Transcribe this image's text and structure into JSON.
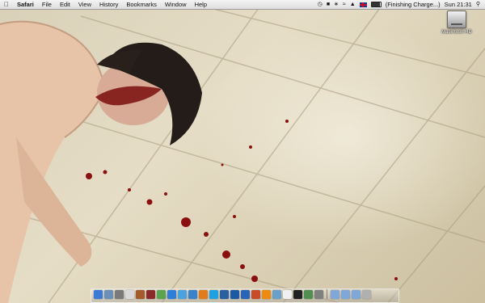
{
  "menubar": {
    "app_name": "Safari",
    "items": [
      "File",
      "Edit",
      "View",
      "History",
      "Bookmarks",
      "Window",
      "Help"
    ],
    "battery_status": "(Finishing Charge...)",
    "battery_level": 0.95,
    "clock": "Sun 21:31",
    "status_icons": [
      "time-machine-icon",
      "adium-icon",
      "bluetooth-icon",
      "wifi-icon",
      "volume-icon",
      "flag-uk-icon",
      "battery-icon",
      "spotlight-icon"
    ]
  },
  "desktop": {
    "hd_label": "Macintosh HD"
  },
  "dock": {
    "items": [
      {
        "name": "finder-icon",
        "color": "#3a7bd5"
      },
      {
        "name": "mail-icon",
        "color": "#6c8fb8"
      },
      {
        "name": "system-preferences-icon",
        "color": "#7a7a7a"
      },
      {
        "name": "ical-icon",
        "color": "#d9d9d9"
      },
      {
        "name": "address-book-icon",
        "color": "#a45a2a"
      },
      {
        "name": "dictionary-icon",
        "color": "#8a2a2a"
      },
      {
        "name": "iphoto-icon",
        "color": "#5ba34f"
      },
      {
        "name": "safari-icon",
        "color": "#2f7ed8"
      },
      {
        "name": "ichat-icon",
        "color": "#4aa3df"
      },
      {
        "name": "itunes-icon",
        "color": "#3c82c8"
      },
      {
        "name": "firefox-icon",
        "color": "#e07b20"
      },
      {
        "name": "skype-icon",
        "color": "#1fa0e0"
      },
      {
        "name": "network-icon",
        "color": "#2a5fa0"
      },
      {
        "name": "photoshop-icon",
        "color": "#1c5aa6"
      },
      {
        "name": "word-icon",
        "color": "#2a64b8"
      },
      {
        "name": "powerpoint-icon",
        "color": "#c94a2a"
      },
      {
        "name": "vlc-icon",
        "color": "#ee8a10"
      },
      {
        "name": "preview-icon",
        "color": "#6aa0c8"
      },
      {
        "name": "textedit-icon",
        "color": "#f0f0f0"
      },
      {
        "name": "terminal-icon",
        "color": "#222222"
      },
      {
        "name": "activity-icon",
        "color": "#4f8f4f"
      },
      {
        "name": "utility-icon",
        "color": "#808080"
      },
      {
        "name": "folder-icon",
        "color": "#7fa8d8"
      },
      {
        "name": "documents-folder-icon",
        "color": "#7fa8d8"
      },
      {
        "name": "downloads-folder-icon",
        "color": "#7fa8d8"
      },
      {
        "name": "trash-icon",
        "color": "#b0b0b0"
      }
    ]
  }
}
